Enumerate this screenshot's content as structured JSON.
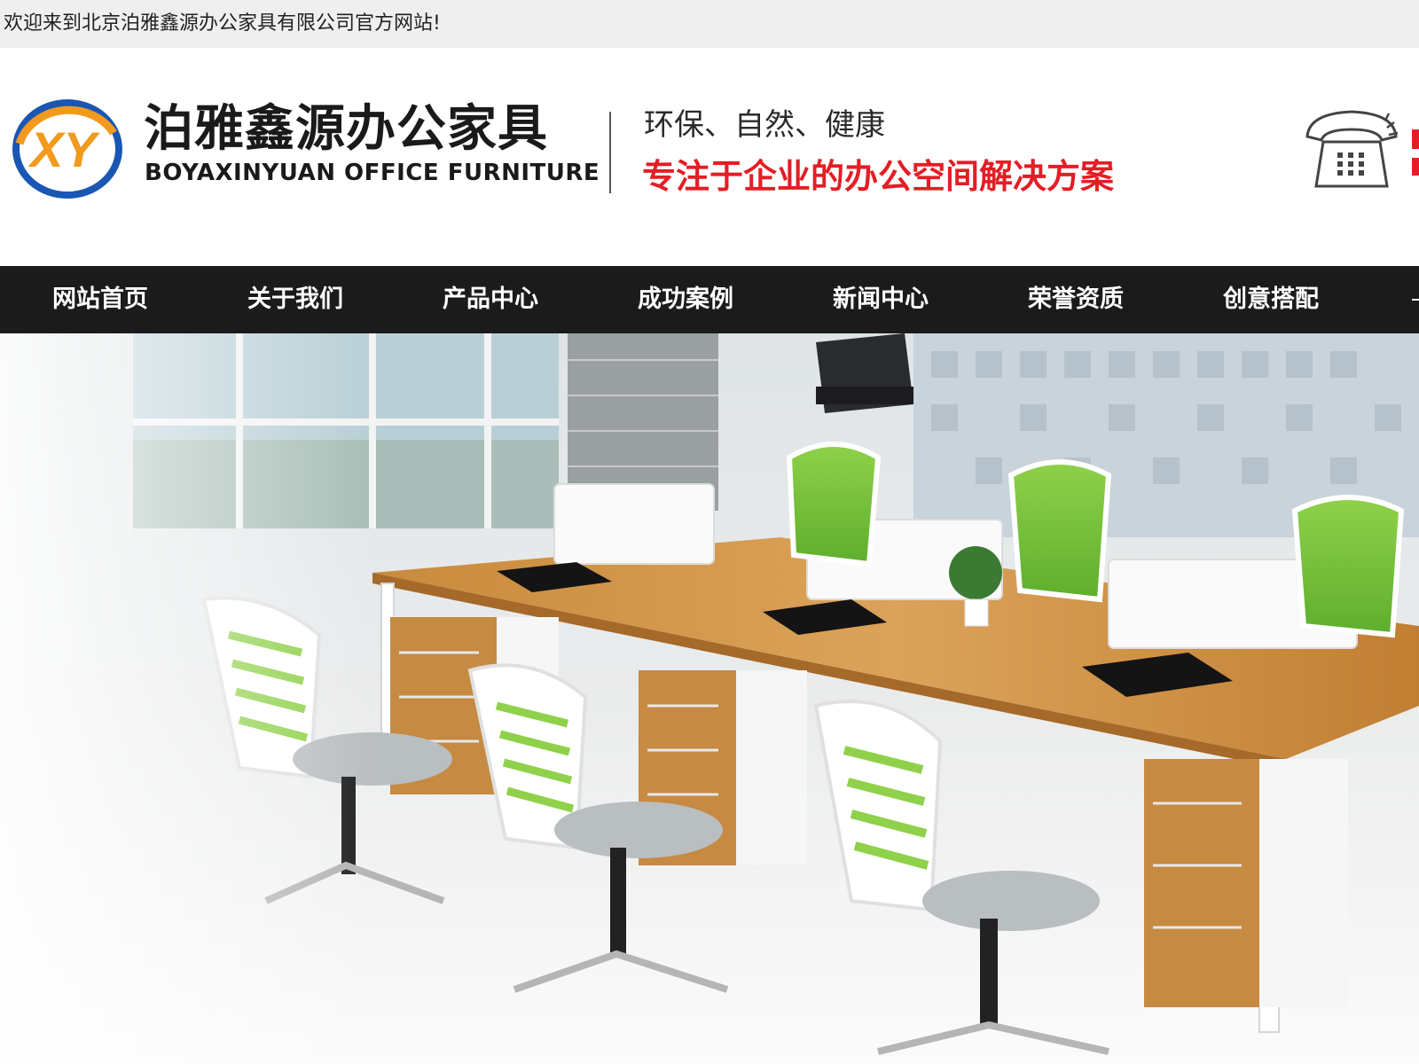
{
  "topbar": {
    "welcome_text": "欢迎来到北京泊雅鑫源办公家具有限公司官方网站!"
  },
  "header": {
    "logo": {
      "mark_text": "XY",
      "name_cn": "泊雅鑫源办公家具",
      "name_en": "BOYAXINYUAN OFFICE FURNITURE"
    },
    "slogan_primary": "环保、自然、健康",
    "slogan_secondary": "专注于企业的办公空间解决方案",
    "phone_icon": "telephone-icon",
    "colors": {
      "slogan_accent": "#e31e25",
      "logo_ring_blue": "#1a56b3",
      "logo_ring_orange": "#f29a1d"
    }
  },
  "nav": {
    "items": [
      {
        "label": "网站首页"
      },
      {
        "label": "关于我们"
      },
      {
        "label": "产品中心"
      },
      {
        "label": "成功案例"
      },
      {
        "label": "新闻中心"
      },
      {
        "label": "荣誉资质"
      },
      {
        "label": "创意搭配"
      }
    ],
    "background": "#1b1b1b"
  },
  "banner": {
    "image": "office-workstation-photo"
  }
}
